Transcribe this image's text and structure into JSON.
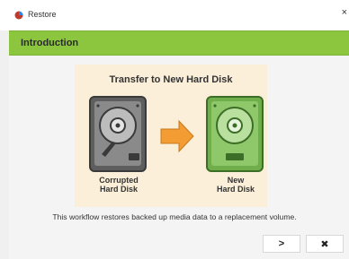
{
  "window": {
    "title": "Restore",
    "close_glyph": "×"
  },
  "header": {
    "title": "Introduction"
  },
  "illustration": {
    "title": "Transfer to New Hard Disk",
    "left_disk": {
      "label_line1": "Corrupted",
      "label_line2": "Hard Disk",
      "color": "#6b6b6b"
    },
    "right_disk": {
      "label_line1": "New",
      "label_line2": "Hard Disk",
      "color": "#6fae4a"
    },
    "arrow_color": "#f39c34",
    "background": "#fbefd9"
  },
  "description": "This workflow restores backed up media data to a replacement volume.",
  "buttons": {
    "next_glyph": ">",
    "close_glyph": "✖"
  },
  "colors": {
    "accent": "#8cc63f"
  }
}
